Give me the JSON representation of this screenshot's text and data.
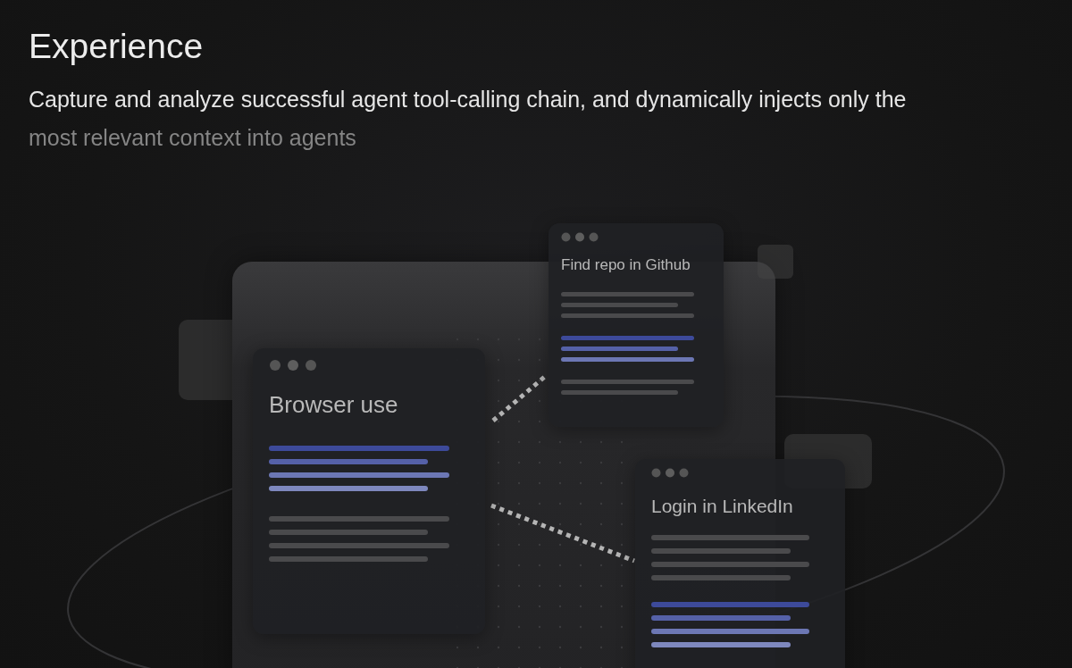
{
  "heading": "Experience",
  "description": [
    {
      "text": "Capture and analyze successful agent tool-calling chain, and dynamically injects only the",
      "dimmed": false
    },
    {
      "text": "most relevant context into agents",
      "dimmed": true
    }
  ],
  "task_cards": [
    {
      "title": "Browser use",
      "line_groups": [
        {
          "kind": "accent",
          "lines": [
            {
              "kind": "long"
            },
            {
              "kind": "short"
            },
            {
              "kind": "long"
            },
            {
              "kind": "short"
            }
          ]
        },
        {
          "kind": "plain",
          "lines": [
            {
              "kind": "long"
            },
            {
              "kind": "short"
            },
            {
              "kind": "long"
            },
            {
              "kind": "short"
            }
          ]
        }
      ]
    },
    {
      "title": "Find repo in Github",
      "line_groups": [
        {
          "kind": "plain",
          "lines": [
            {
              "kind": "long"
            },
            {
              "kind": "short"
            },
            {
              "kind": "long"
            }
          ]
        },
        {
          "kind": "accent",
          "lines": [
            {
              "kind": "long"
            },
            {
              "kind": "short"
            },
            {
              "kind": "long"
            }
          ]
        },
        {
          "kind": "plain",
          "lines": [
            {
              "kind": "long"
            },
            {
              "kind": "short"
            }
          ]
        }
      ]
    },
    {
      "title": "Login in LinkedIn",
      "line_groups": [
        {
          "kind": "plain",
          "lines": [
            {
              "kind": "long"
            },
            {
              "kind": "short"
            },
            {
              "kind": "long"
            },
            {
              "kind": "short"
            }
          ]
        },
        {
          "kind": "accent",
          "lines": [
            {
              "kind": "long"
            },
            {
              "kind": "short"
            },
            {
              "kind": "long"
            },
            {
              "kind": "short"
            }
          ]
        }
      ]
    }
  ]
}
